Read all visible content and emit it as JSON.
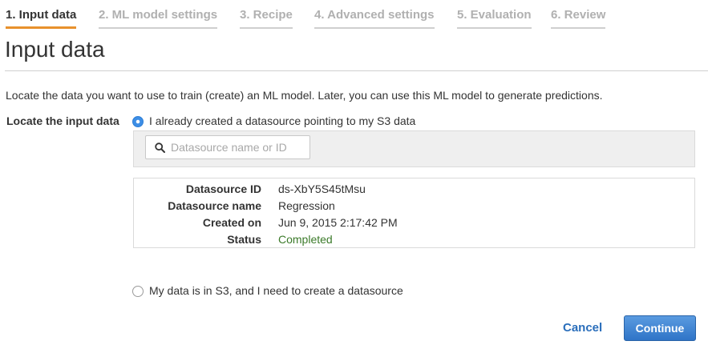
{
  "wizard": {
    "steps": [
      {
        "label": "1. Input data",
        "active": true
      },
      {
        "label": "2. ML model settings",
        "active": false
      },
      {
        "label": "3. Recipe",
        "active": false
      },
      {
        "label": "4. Advanced settings",
        "active": false
      },
      {
        "label": "5. Evaluation",
        "active": false
      },
      {
        "label": "6. Review",
        "active": false
      }
    ]
  },
  "page": {
    "title": "Input data",
    "intro": "Locate the data you want to use to train (create) an ML model. Later, you can use this ML model to generate predictions."
  },
  "form": {
    "field_label": "Locate the input data",
    "option_existing": "I already created a datasource pointing to my S3 data",
    "option_new": "My data is in S3, and I need to create a datasource",
    "selected_option": "existing",
    "search": {
      "placeholder": "Datasource name or ID",
      "value": "",
      "icon": "search-icon"
    }
  },
  "datasource": {
    "rows": [
      {
        "key": "Datasource ID",
        "value": "ds-XbY5S45tMsu"
      },
      {
        "key": "Datasource name",
        "value": "Regression"
      },
      {
        "key": "Created on",
        "value": "Jun 9, 2015 2:17:42 PM"
      },
      {
        "key": "Status",
        "value": "Completed"
      }
    ]
  },
  "actions": {
    "cancel_label": "Cancel",
    "continue_label": "Continue"
  },
  "colors": {
    "accent": "#e8912d",
    "link": "#2a6ebb",
    "primary_button": "#3a80d0",
    "status_ok": "#3b7a29"
  }
}
